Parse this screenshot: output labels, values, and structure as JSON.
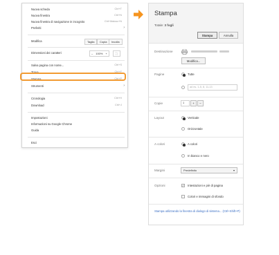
{
  "menu": {
    "items": [
      {
        "label": "Nuova scheda",
        "shortcut": "Ctrl+T"
      },
      {
        "label": "Nuova finestra",
        "shortcut": "Ctrl+N"
      },
      {
        "label": "Nuova finestra di navigazione in incognito",
        "shortcut": "Ctrl+Maiusc+N"
      },
      {
        "label": "Preferiti"
      }
    ],
    "edit": {
      "label": "Modifica",
      "cut": "Taglia",
      "copy": "Copia",
      "paste": "Incolla"
    },
    "zoom": {
      "label": "Dimensioni dei caratteri",
      "minus": "–",
      "value": "100%",
      "plus": "+"
    },
    "items2": [
      {
        "label": "Salva pagina con nome...",
        "shortcut": "Ctrl+S"
      },
      {
        "label": "Trova...",
        "shortcut": "Ctrl+F"
      },
      {
        "label": "Stampa...",
        "shortcut": "Ctrl+P"
      },
      {
        "label": "Strumenti"
      }
    ],
    "items3": [
      {
        "label": "Cronologia",
        "shortcut": "Ctrl+H"
      },
      {
        "label": "Download",
        "shortcut": "Ctrl+J"
      }
    ],
    "items4": [
      {
        "label": "Impostazioni"
      },
      {
        "label": "Informazioni su Google Chrome"
      },
      {
        "label": "Guida"
      }
    ],
    "exit": {
      "label": "Esci"
    }
  },
  "print": {
    "title": "Stampa",
    "total_prefix": "Totale:",
    "total_value": "3 fogli",
    "print_button": "Stampa",
    "cancel_button": "Annulla",
    "destination_label": "Destinazione",
    "modify_button": "Modifica...",
    "pages_label": "Pagine",
    "pages_all": "Tutte",
    "pages_placeholder": "ad es. 1-5, 8, 11-13",
    "copies_label": "Copie",
    "copies_value": "1",
    "copies_plus": "+",
    "copies_minus": "–",
    "layout_label": "Layout",
    "layout_portrait": "Verticale",
    "layout_landscape": "Orizzontale",
    "color_label": "A colori",
    "color_color": "A colori",
    "color_bw": "In bianco e nero",
    "margins_label": "Margini",
    "margins_value": "Predefinito",
    "options_label": "Opzioni",
    "option_headers": "Intestazioni e piè di pagina",
    "option_bg": "Colori e immagini di sfondo",
    "system_dialog_link": "Stampa utilizzando la finestra di dialogo di sistema... (Ctrl+Shift+P)"
  },
  "colors": {
    "highlight": "#f29a30",
    "arrow": "#f5941f",
    "link": "#3b6fc4"
  }
}
